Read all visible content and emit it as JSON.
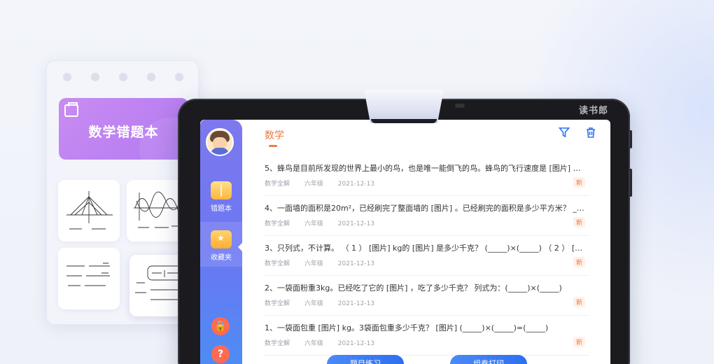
{
  "tablet": {
    "brand": "读书郎"
  },
  "notebook": {
    "title": "数学错题本"
  },
  "sidebar": {
    "items": [
      {
        "label": "错题本",
        "icon": "book-icon"
      },
      {
        "label": "收藏夹",
        "icon": "folder-star-icon"
      }
    ],
    "bottom_icons": [
      "lock-icon",
      "help-icon"
    ],
    "help_glyph": "?"
  },
  "main": {
    "tab": "数学",
    "questions": [
      {
        "text": "5、蜂鸟是目前所发现的世界上最小的鸟，也是唯一能倒飞的鸟。蜂鸟的飞行速度是 [图片] 千…",
        "source": "数学全解",
        "grade": "六年级",
        "date": "2021-12-13",
        "badge": "新"
      },
      {
        "text": "4、一面墙的面积是20m²，已经刷完了整面墙的 [图片] 。已经刷完的面积是多少平方米？ ___…",
        "source": "数学全解",
        "grade": "六年级",
        "date": "2021-12-13",
        "badge": "新"
      },
      {
        "text": "3、只列式，不计算。 （ 1 ） [图片] kg的 [图片] 是多少千克？ (_____)×(_____) （ 2 ） [图片]…",
        "source": "数学全解",
        "grade": "六年级",
        "date": "2021-12-13",
        "badge": "新"
      },
      {
        "text": "2、一袋面粉重3kg。已经吃了它的 [图片] ，吃了多少千克？ 列式为：(_____)×(_____)",
        "source": "数学全解",
        "grade": "六年级",
        "date": "2021-12-13",
        "badge": "新"
      },
      {
        "text": "1、一袋面包重 [图片] kg。3袋面包重多少千克？ [图片] (_____)×(_____)=(_____)",
        "source": "数学全解",
        "grade": "六年级",
        "date": "2021-12-13",
        "badge": "新"
      }
    ],
    "buttons": {
      "practice": "题目练习",
      "print": "组卷打印"
    }
  },
  "colors": {
    "accent": "#2f6ff5",
    "tab_active": "#f07a3c",
    "notebook_purple": "#b27af0"
  }
}
